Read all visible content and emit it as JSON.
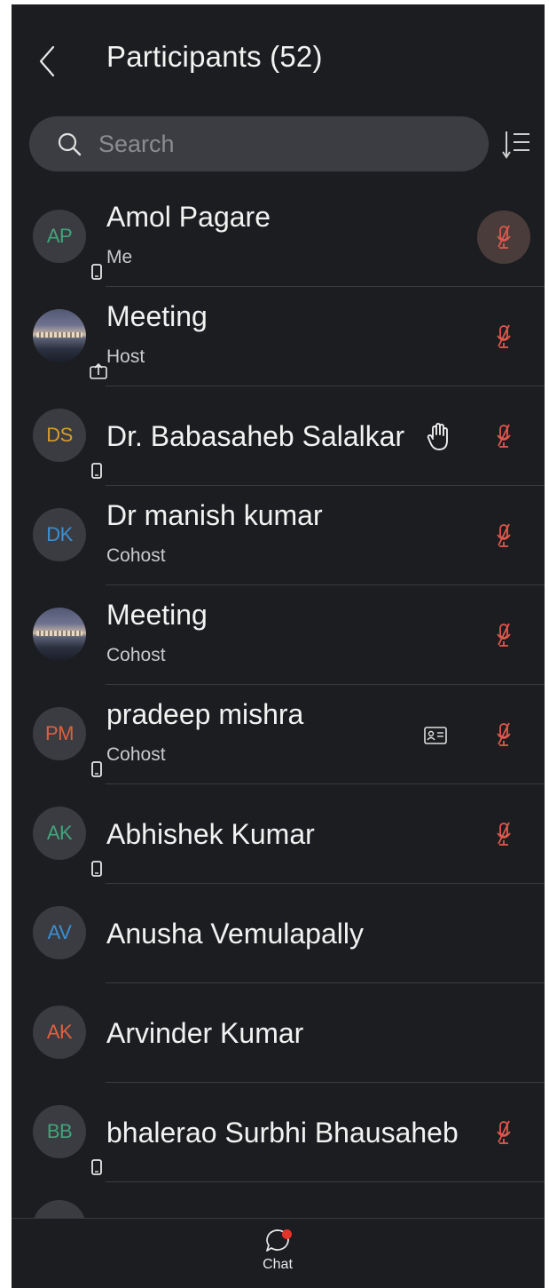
{
  "colors": {
    "background": "#1c1d20",
    "muted_red": "#e2574c",
    "text": "#f2f2f2",
    "subtext": "#c9cacd",
    "notification_dot": "#e5332a"
  },
  "header": {
    "back_icon": "chevron-left-icon",
    "title": "Participants (52)",
    "sort_icon": "sort-list-icon"
  },
  "search": {
    "placeholder": "Search",
    "value": ""
  },
  "participants": [
    {
      "initials": "AP",
      "name": "Amol Pagare",
      "role": "Me",
      "initials_color": "#43a37a",
      "device_badge": "phone-icon",
      "muted": true,
      "is_me": true
    },
    {
      "initials": "",
      "name": "Meeting",
      "role": "Host",
      "photo": true,
      "device_badge": "share-screen-icon",
      "muted": true
    },
    {
      "initials": "DS",
      "name": "Dr. Babasaheb Salalkar",
      "role": "",
      "initials_color": "#d89a2e",
      "device_badge": "phone-icon",
      "hand_raised": true,
      "muted": true
    },
    {
      "initials": "DK",
      "name": "Dr manish kumar",
      "role": "Cohost",
      "initials_color": "#3b8fd4",
      "muted": true
    },
    {
      "initials": "",
      "name": "Meeting",
      "role": "Cohost",
      "photo": true,
      "muted": true
    },
    {
      "initials": "PM",
      "name": "pradeep mishra",
      "role": "Cohost",
      "initials_color": "#e0603e",
      "device_badge": "phone-icon",
      "card_icon": true,
      "muted": true
    },
    {
      "initials": "AK",
      "name": "Abhishek Kumar",
      "role": "",
      "initials_color": "#43a37a",
      "device_badge": "phone-icon",
      "muted": true
    },
    {
      "initials": "AV",
      "name": "Anusha Vemulapally",
      "role": "",
      "initials_color": "#3b8fd4",
      "muted": false
    },
    {
      "initials": "AK",
      "name": "Arvinder Kumar",
      "role": "",
      "initials_color": "#e0603e",
      "muted": false
    },
    {
      "initials": "BB",
      "name": "bhalerao Surbhi Bhausaheb",
      "role": "",
      "initials_color": "#43a37a",
      "device_badge": "phone-icon",
      "muted": true
    }
  ],
  "bottom_bar": {
    "chat_label": "Chat",
    "chat_icon": "chat-bubble-icon",
    "has_notification": true
  }
}
